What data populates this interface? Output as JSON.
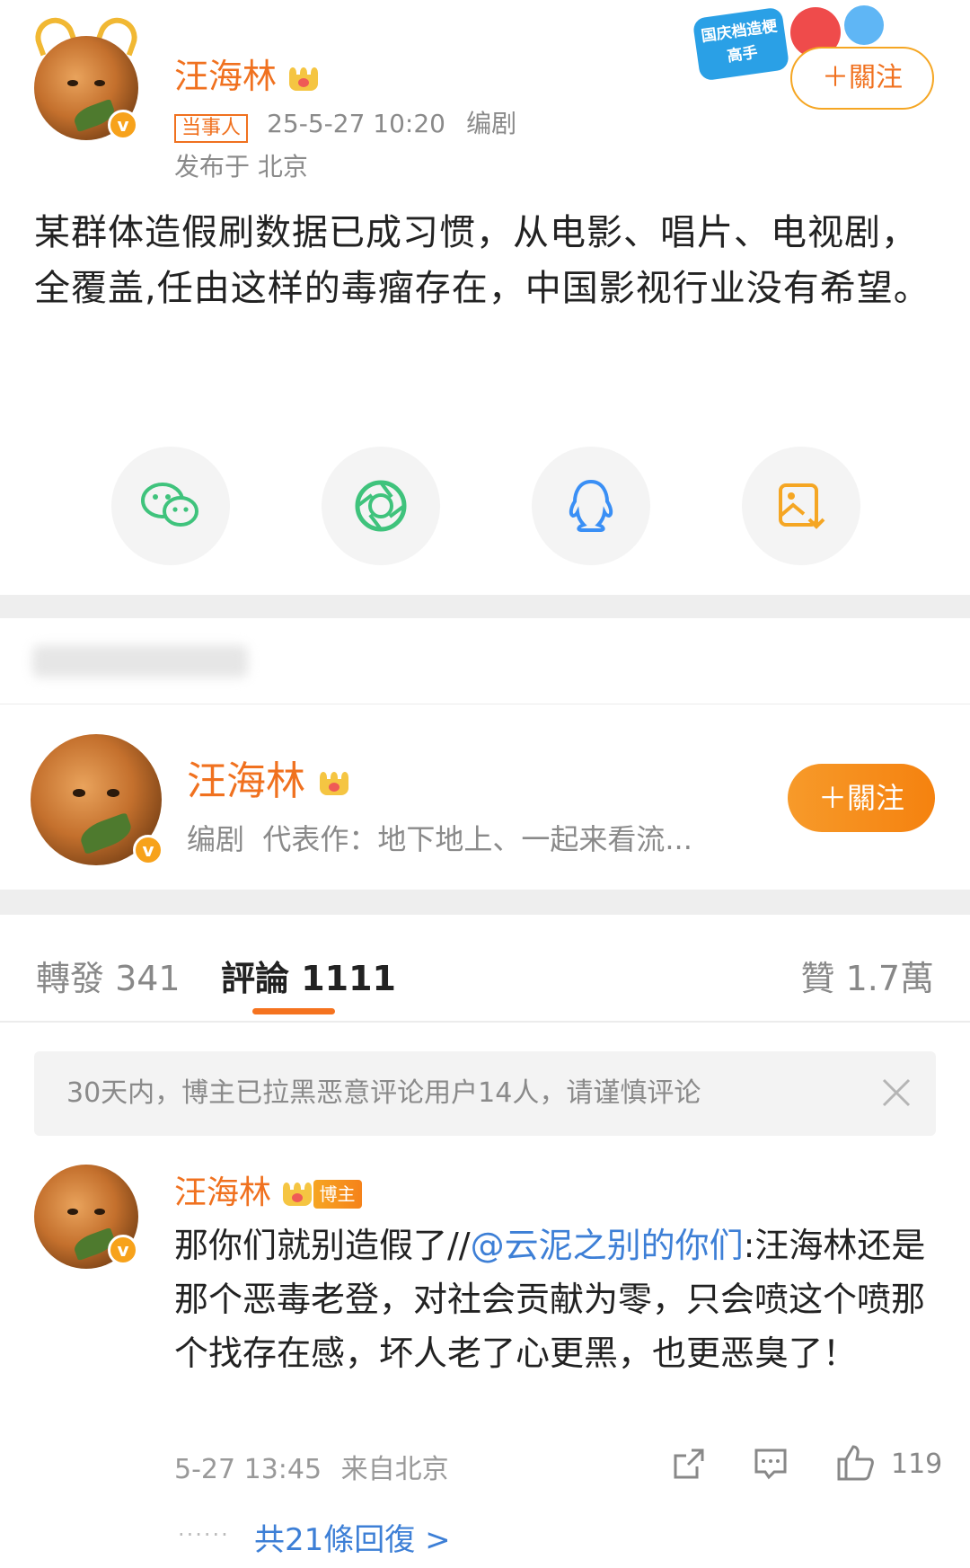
{
  "post": {
    "author_name": "汪海林",
    "tag": "当事人",
    "time": "25-5-27 10:20",
    "role": "编剧",
    "location": "发布于 北京",
    "text": "某群体造假刷数据已成习惯，从电影、唱片、电视剧，全覆盖,任由这样的毒瘤存在，中国影视行业没有希望。",
    "follow_label": "＋關注",
    "event_badge": "国庆档造梗高手"
  },
  "share": {
    "icons": [
      "wechat-icon",
      "moments-icon",
      "qq-icon",
      "save-image-icon"
    ],
    "colors": {
      "wechat": "#3fc37c",
      "moments": "#3fc37c",
      "qq": "#3a8ff5",
      "save": "#f5a623"
    }
  },
  "author_card": {
    "name": "汪海林",
    "bio": "编剧  代表作：地下地上、一起来看流...",
    "follow_label": "＋關注"
  },
  "tabs": {
    "repost": "轉發 341",
    "comment": "評論 1111",
    "like": "贊 1.7萬"
  },
  "notice": {
    "text": "30天内，博主已拉黑恶意评论用户14人，请谨慎评论"
  },
  "comment": {
    "author": "汪海林",
    "badge": "博主",
    "text_before": "那你们就别造假了//",
    "mention": "@云泥之别的你们",
    "text_after": ":汪海林还是那个恶毒老登，对社会贡献为零，只会喷这个喷那个找存在感，坏人老了心更黑，也更恶臭了！",
    "time": "5-27 13:45",
    "source": "来自北京",
    "likes": "119",
    "replies": "共21條回復 >"
  },
  "colors": {
    "accent": "#f0711f",
    "link": "#3d7fd6",
    "verified": "#f7a21b"
  }
}
